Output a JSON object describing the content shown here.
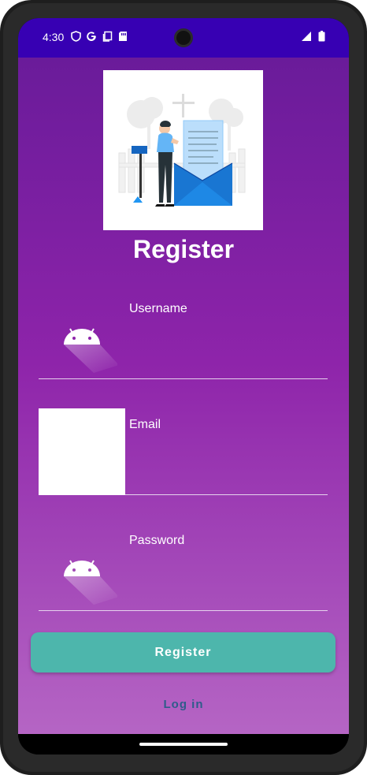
{
  "status_bar": {
    "time": "4:30",
    "icons_left": [
      "shield-icon",
      "google-icon",
      "copy-icon",
      "sd-card-icon"
    ],
    "icons_right": [
      "signal-icon",
      "battery-icon"
    ]
  },
  "screen": {
    "title": "Register",
    "fields": [
      {
        "label": "Username",
        "icon": "android-icon"
      },
      {
        "label": "Email",
        "icon": "image-placeholder"
      },
      {
        "label": "Password",
        "icon": "android-icon"
      }
    ],
    "register_button": "Register",
    "login_link": "Log in"
  },
  "colors": {
    "status_bar": "#3700b3",
    "gradient_top": "#6a1b9a",
    "gradient_bottom": "#b565c4",
    "button": "#4db6ac",
    "link": "#2f5c8a"
  }
}
